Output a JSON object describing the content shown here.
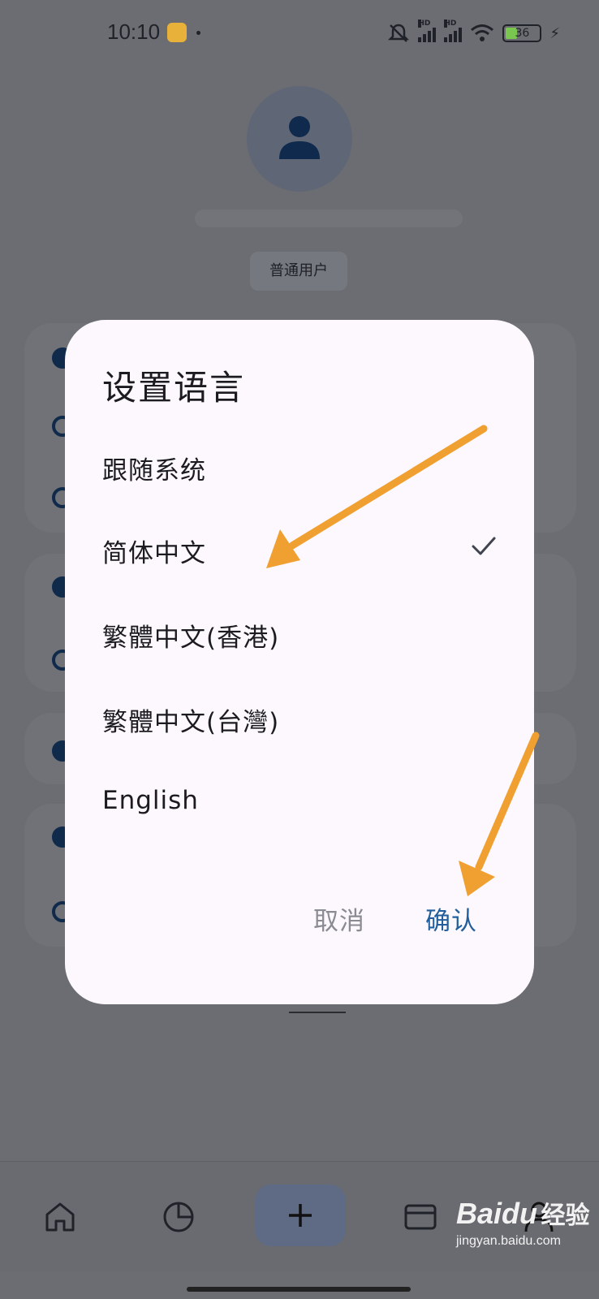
{
  "status_bar": {
    "time": "10:10",
    "network_labels": [
      "HD",
      "HD"
    ],
    "battery": "36"
  },
  "profile": {
    "role": "普通用户"
  },
  "dialog": {
    "title": "设置语言",
    "options": [
      {
        "label": "跟随系统",
        "selected": false
      },
      {
        "label": "简体中文",
        "selected": true
      },
      {
        "label": "繁體中文(香港)",
        "selected": false
      },
      {
        "label": "繁體中文(台灣)",
        "selected": false
      },
      {
        "label": "English",
        "selected": false
      }
    ],
    "cancel_label": "取消",
    "confirm_label": "确认"
  },
  "bottom_nav": {
    "items": [
      "home-icon",
      "chart-pie-icon",
      "add-icon",
      "card-icon",
      "person-icon"
    ]
  },
  "watermark": {
    "brand": "Bai",
    "brand_du": "du",
    "cn": "经验",
    "url": "jingyan.baidu.com"
  },
  "colors": {
    "accent": "#225f9c",
    "arrow": "#f0a030",
    "dialog_bg": "#fcf8fd",
    "scrim": "#6b6d72"
  }
}
